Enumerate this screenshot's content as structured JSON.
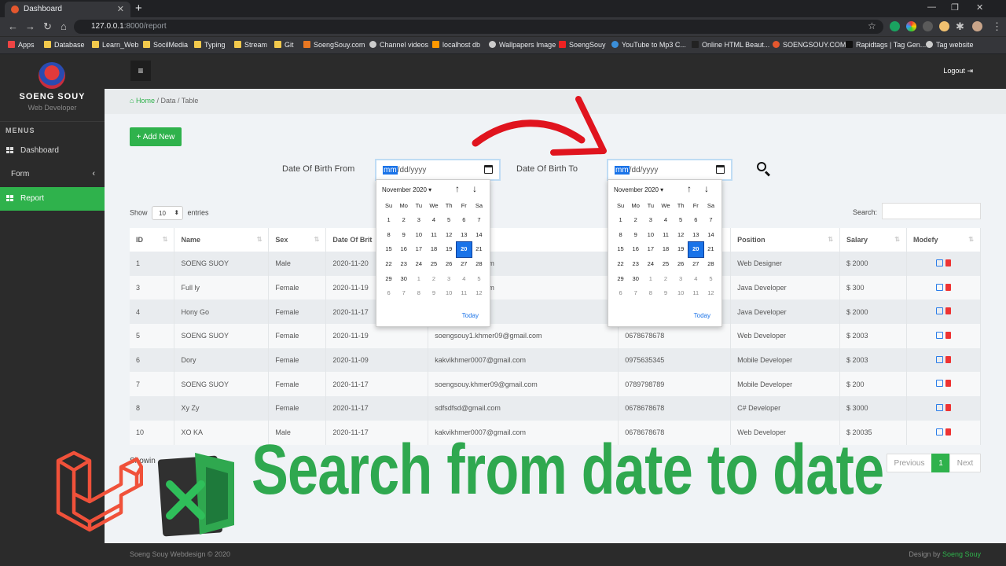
{
  "browser": {
    "tab_title": "Dashboard",
    "url_host": "127.0.0.1",
    "url_path": ":8000/report",
    "bookmarks": [
      "Apps",
      "Database",
      "Learn_Web",
      "SocilMedia",
      "Typing",
      "Stream",
      "Git",
      "SoengSouy.com",
      "Channel videos",
      "localhost db",
      "Wallpapers Image",
      "SoengSouy",
      "YouTube to Mp3 C...",
      "Online HTML Beaut...",
      "SOENGSOUY.COM",
      "Rapidtags | Tag Gen...",
      "Tag website"
    ]
  },
  "sidebar": {
    "brand": "SOENG SOUY",
    "role": "Web Developer",
    "menus_label": "MENUS",
    "items": [
      {
        "label": "Dashboard"
      },
      {
        "label": "Form"
      },
      {
        "label": "Report"
      }
    ]
  },
  "topbar": {
    "hamburger": "≡",
    "logout": "Logout"
  },
  "breadcrumb": {
    "home": "Home",
    "rest": "/  Data / Table"
  },
  "toolbar": {
    "add_new": "+ Add New",
    "dob_from_label": "Date Of Birth From",
    "dob_to_label": "Date Of Birth To",
    "date_placeholder_mm": "mm",
    "date_placeholder_rest": "/dd/yyyy"
  },
  "table_controls": {
    "show": "Show",
    "length": "10",
    "entries": "entries",
    "search": "Search:"
  },
  "datepicker": {
    "month": "November 2020 ▾",
    "weekdays": [
      "Su",
      "Mo",
      "Tu",
      "We",
      "Th",
      "Fr",
      "Sa"
    ],
    "days": [
      "1",
      "2",
      "3",
      "4",
      "5",
      "6",
      "7",
      "8",
      "9",
      "10",
      "11",
      "12",
      "13",
      "14",
      "15",
      "16",
      "17",
      "18",
      "19",
      "20",
      "21",
      "22",
      "23",
      "24",
      "25",
      "26",
      "27",
      "28",
      "29",
      "30",
      "1",
      "2",
      "3",
      "4",
      "5",
      "6",
      "7",
      "8",
      "9",
      "10",
      "11",
      "12"
    ],
    "selected": "20",
    "today": "Today"
  },
  "table": {
    "columns": [
      "ID",
      "Name",
      "Sex",
      "Date Of Brit",
      "",
      "",
      "Position",
      "Salary",
      "Modefy"
    ],
    "rows": [
      [
        "1",
        "SOENG SUOY",
        "Male",
        "2020-11-20",
        "mer09@gmail.com",
        "",
        "Web Designer",
        "$ 2000"
      ],
      [
        "3",
        "Full ly",
        "Female",
        "2020-11-19",
        "mer09@gmail.com",
        "",
        "Java Developer",
        "$ 300"
      ],
      [
        "4",
        "Hony Go",
        "Female",
        "2020-11-17",
        "com",
        "",
        "Java Developer",
        "$ 2000"
      ],
      [
        "5",
        "SOENG SUOY",
        "Female",
        "2020-11-19",
        "soengsouy1.khmer09@gmail.com",
        "0678678678",
        "Web Developer",
        "$ 2003"
      ],
      [
        "6",
        "Dory",
        "Female",
        "2020-11-09",
        "kakvikhmer0007@gmail.com",
        "0975635345",
        "Mobile Developer",
        "$ 2003"
      ],
      [
        "7",
        "SOENG SUOY",
        "Female",
        "2020-11-17",
        "soengsouy.khmer09@gmail.com",
        "0789798789",
        "Mobile Developer",
        "$ 200"
      ],
      [
        "8",
        "Xy Zy",
        "Female",
        "2020-11-17",
        "sdfsdfsd@gmail.com",
        "0678678678",
        "C# Developer",
        "$ 3000"
      ],
      [
        "10",
        "XO KA",
        "Male",
        "2020-11-17",
        "kakvikhmer0007@gmail.com",
        "0678678678",
        "Web Developer",
        "$ 20035"
      ]
    ]
  },
  "pagination": {
    "showing": "Showin",
    "previous": "Previous",
    "current": "1",
    "next": "Next"
  },
  "footer": {
    "left": "Soeng Souy Webdesign © 2020",
    "right_prefix": "Design by ",
    "right_name": "Soeng Souy"
  },
  "overlay": {
    "title": "Search from date to date"
  },
  "colors": {
    "accent": "#2fb24c",
    "overlay_green": "#2fa84f",
    "dark": "#2b2b2b",
    "arrow_red": "#e0141e"
  }
}
